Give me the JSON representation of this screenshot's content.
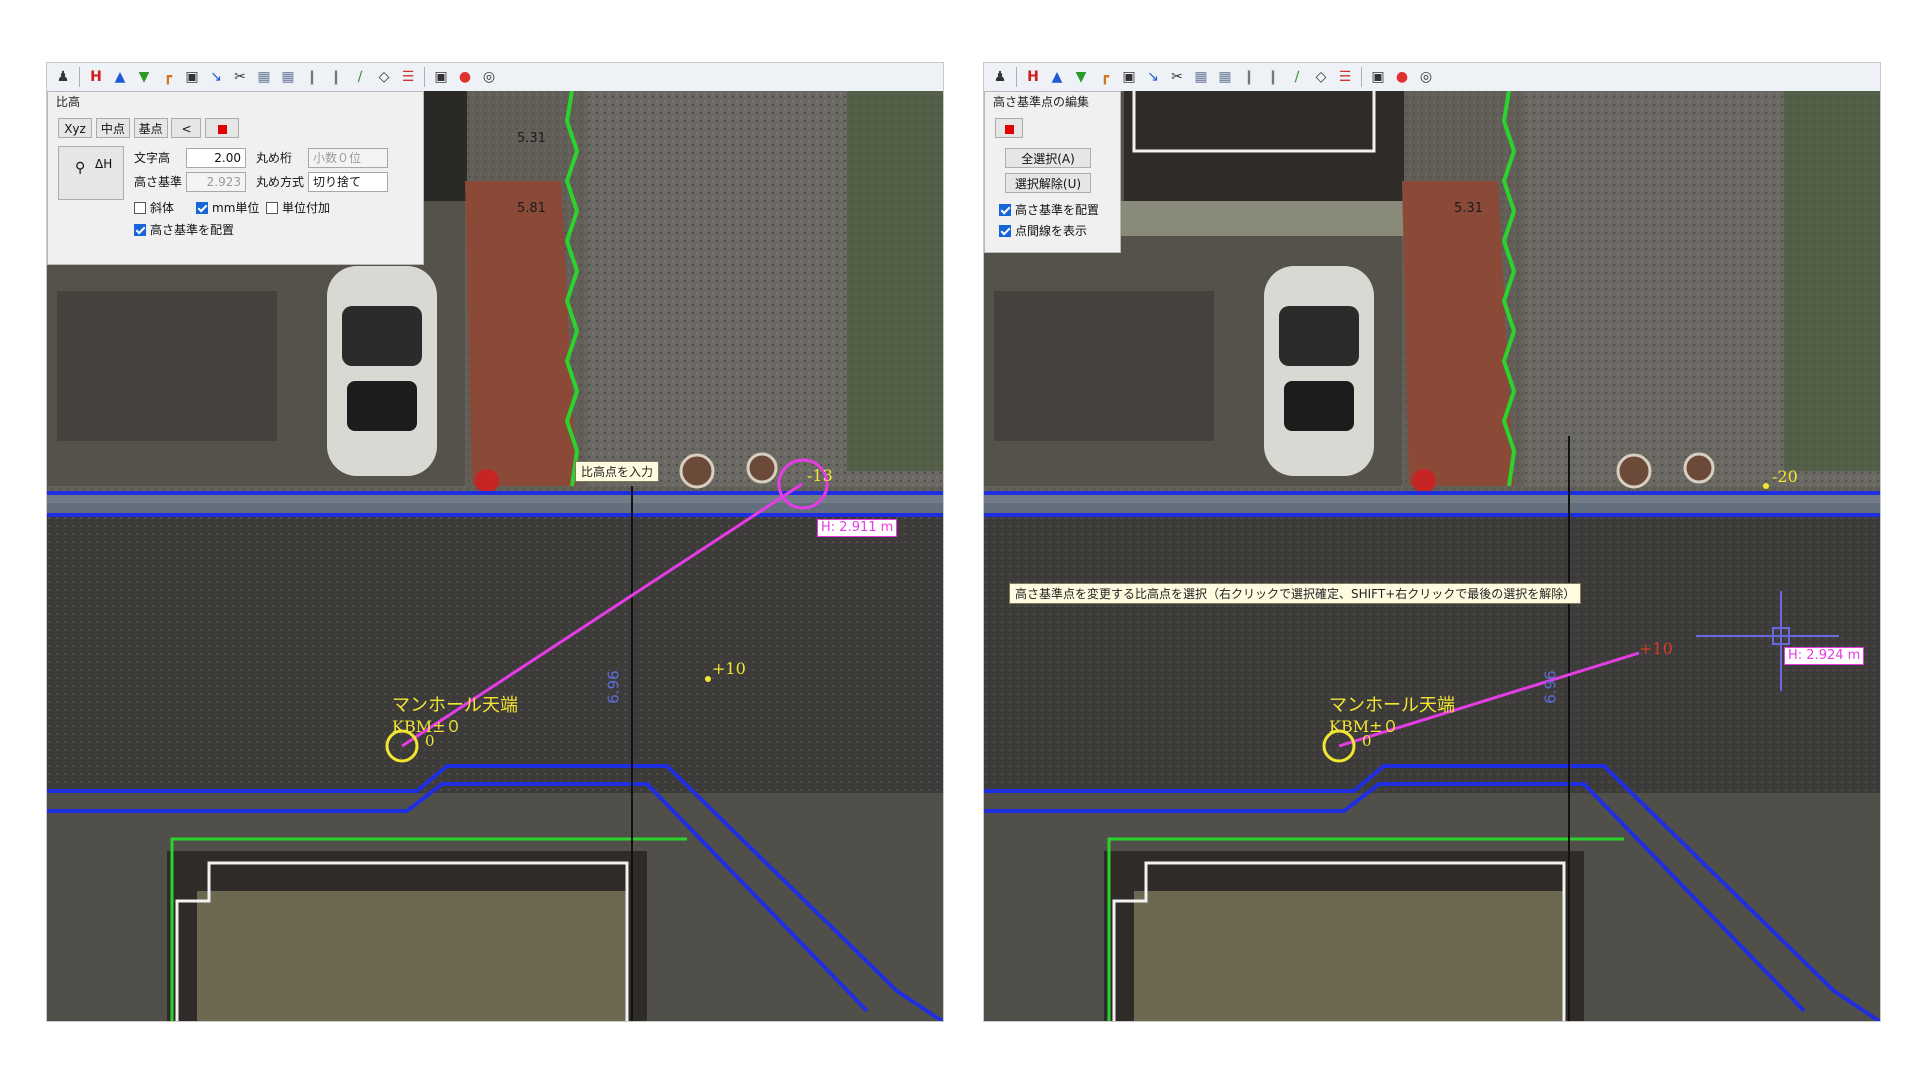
{
  "toolbar": {
    "icons": [
      "person-icon",
      "height-icon",
      "elevation-icon",
      "level-icon",
      "corner-icon",
      "camera-icon",
      "path-icon",
      "scissors-icon",
      "layer-icon",
      "layer2-icon",
      "columns-icon",
      "columns2-icon",
      "line-icon",
      "diamond-icon",
      "stack-icon",
      "frame-icon",
      "pin-icon",
      "target-icon"
    ]
  },
  "left": {
    "dialog": {
      "title": "比高",
      "tabs": [
        "Xyz",
        "中点",
        "基点",
        "<"
      ],
      "dh_label": "ΔH",
      "text_height_label": "文字高",
      "text_height_value": "2.00",
      "height_ref_label": "高さ基準",
      "height_ref_value": "2.923",
      "round_digits_label": "丸め桁",
      "round_digits_value": "小数０位",
      "round_method_label": "丸め方式",
      "round_method_value": "切り捨て",
      "italic_label": "斜体",
      "mm_unit_label": "mm単位",
      "add_unit_label": "単位付加",
      "place_ref_label": "高さ基準を配置"
    },
    "tooltip": "比高点を入力",
    "h_readout": "H: 2.911 m",
    "point_label": "-13",
    "plus10_label": "+10",
    "dist_label": "6.96",
    "manhole_label": "マンホール天端",
    "kbm_label": "KBM±０",
    "zero_label": "0",
    "top_labels": [
      "5.31",
      "5.81"
    ]
  },
  "right": {
    "dialog": {
      "title": "高さ基準点の編集",
      "select_all": "全選択(A)",
      "deselect": "選択解除(U)",
      "place_ref_label": "高さ基準を配置",
      "show_lines_label": "点間線を表示"
    },
    "tooltip": "高さ基準点を変更する比高点を選択（右クリックで選択確定、SHIFT+右クリックで最後の選択を解除）",
    "h_readout": "H: 2.924 m",
    "minus20_label": "-20",
    "plus10_label": "+10",
    "dist_label": "6.96",
    "manhole_label": "マンホール天端",
    "kbm_label": "KBM±０",
    "zero_label": "0",
    "top_labels": [
      "5.31"
    ]
  },
  "colors": {
    "road": "#3d3c3a",
    "ground": "#625f59",
    "curb_blue": "#1f2fe0",
    "green_line": "#2cd32c",
    "magenta": "#e63ce6",
    "yellow": "#f2e633",
    "brick": "#8a4a37",
    "roof": "#2e2b28",
    "yard": "#6c6852"
  }
}
